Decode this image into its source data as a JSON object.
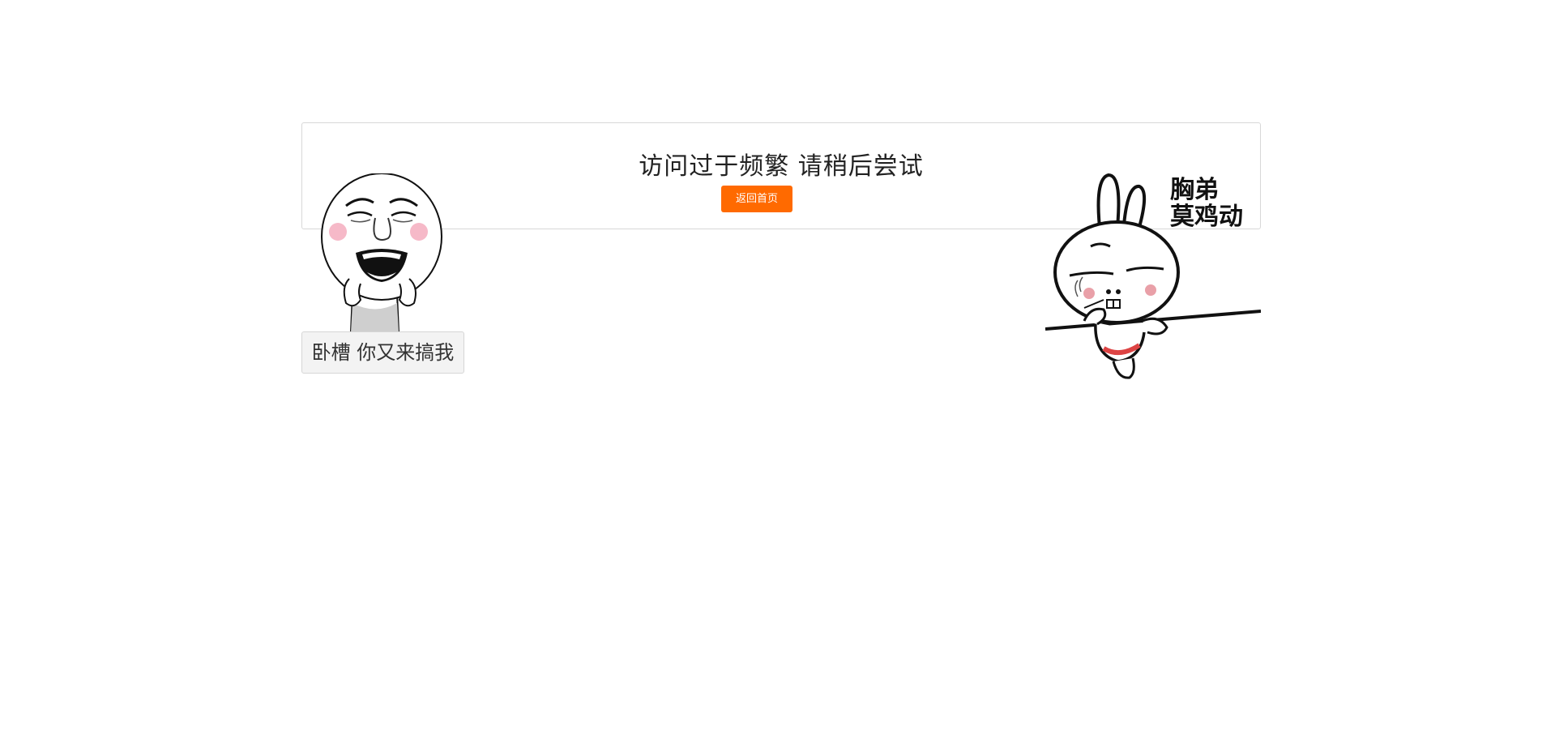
{
  "notice": {
    "title": "访问过于频繁  请稍后尝试",
    "home_button_label": "返回首页",
    "accent_color": "#ff6a00"
  },
  "left_meme": {
    "icon": "laughing-face-meme-icon",
    "caption": "卧槽  你又来搞我"
  },
  "right_meme": {
    "icon": "rabbit-meme-icon",
    "text_line1": "胸弟",
    "text_line2": "莫鸡动"
  }
}
